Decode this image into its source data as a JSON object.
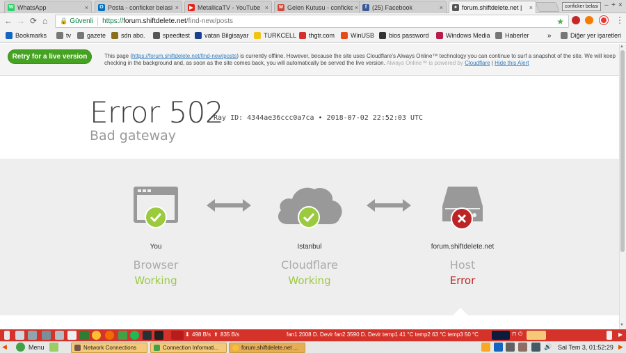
{
  "tabs": [
    {
      "label": "WhatsApp",
      "icon": "whatsapp-icon",
      "color": "#25d366",
      "glyph": "W"
    },
    {
      "label": "Posta - conficker belasi",
      "icon": "outlook-icon",
      "color": "#0072c6",
      "glyph": "O"
    },
    {
      "label": "MetallicaTV - YouTube",
      "icon": "youtube-icon",
      "color": "#e62117",
      "glyph": "▶"
    },
    {
      "label": "Gelen Kutusu - conficke",
      "icon": "gmail-icon",
      "color": "#d44638",
      "glyph": "M"
    },
    {
      "label": "(25) Facebook",
      "icon": "facebook-icon",
      "color": "#3b5998",
      "glyph": "f"
    },
    {
      "label": "forum.shiftdelete.net |",
      "icon": "cloudflare-icon",
      "color": "#555555",
      "glyph": "●"
    }
  ],
  "profile_label": "conficker belasi",
  "toolbar": {
    "secure_label": "Güvenli",
    "url_scheme": "https://",
    "url_host": "forum.shiftdelete.net",
    "url_path": "/find-new/posts"
  },
  "bookmarks": [
    {
      "label": "Bookmarks",
      "icon": "star-icon",
      "color": "#1565c0"
    },
    {
      "label": "tv",
      "icon": "folder-icon",
      "color": "#777777"
    },
    {
      "label": "gazete",
      "icon": "folder-icon",
      "color": "#777777"
    },
    {
      "label": "sdn abo.",
      "icon": "sdn-icon",
      "color": "#8a6d1d"
    },
    {
      "label": "speedtest",
      "icon": "speedtest-icon",
      "color": "#555555"
    },
    {
      "label": "vatan Bilgisayar",
      "icon": "vatan-icon",
      "color": "#1a3f8f"
    },
    {
      "label": "TURKCELL",
      "icon": "turkcell-icon",
      "color": "#f1c40f"
    },
    {
      "label": "thgtr.com",
      "icon": "thgtr-icon",
      "color": "#d32f2f"
    },
    {
      "label": "WinUSB",
      "icon": "winusb-icon",
      "color": "#e64a19"
    },
    {
      "label": "bios password",
      "icon": "bios-icon",
      "color": "#333333"
    },
    {
      "label": "Windows Media",
      "icon": "windows-media-icon",
      "color": "#b71c4a"
    },
    {
      "label": "Haberler",
      "icon": "folder-icon",
      "color": "#777777"
    },
    {
      "label": "Diğer yer işaretleri",
      "icon": "folder-icon",
      "color": "#777777"
    }
  ],
  "alert": {
    "button": "Retry for a live version",
    "text_1": "This page (",
    "text_link": "https://forum.shiftdelete.net/find-new/posts",
    "text_2": ") is currently offline. However, because the site uses Cloudflare's Always Online™ technology you can continue to surf a snapshot of the site. We will keep checking in the background and, as soon as the site comes back, you will automatically be served the live version.",
    "powered": "Always Online™ is powered by",
    "cloudflare": "Cloudflare",
    "divider": "|",
    "hide": "Hide this Alert"
  },
  "error": {
    "title": "Error 502",
    "ray": "Ray ID: 4344ae36ccc0a7ca • 2018-07-02 22:52:03 UTC",
    "subtitle": "Bad gateway"
  },
  "nodes": [
    {
      "label": "You",
      "name": "Browser",
      "status": "Working",
      "ok": true
    },
    {
      "label": "Istanbul",
      "name": "Cloudflare",
      "status": "Working",
      "ok": true
    },
    {
      "label": "forum.shiftdelete.net",
      "name": "Host",
      "status": "Error",
      "ok": false
    }
  ],
  "panel": {
    "net_up": "498 B/s",
    "net_down": "835 B/s",
    "sensors": "fan1 2008 D. Devir fan2 3590 D. Devir temp1 41 °C temp2 63 °C temp3 50 °C"
  },
  "taskbar": {
    "menu": "Menu",
    "tasks": [
      "Network Connections",
      "Connection Informati...",
      "forum.shiftdelete.net ..."
    ],
    "clock": "Sal Tem  3, 01:52:29"
  },
  "colors": {
    "green": "#9bca3e",
    "red": "#bd2426",
    "gray_icon": "#999999",
    "panel_red": "#d5332a"
  }
}
